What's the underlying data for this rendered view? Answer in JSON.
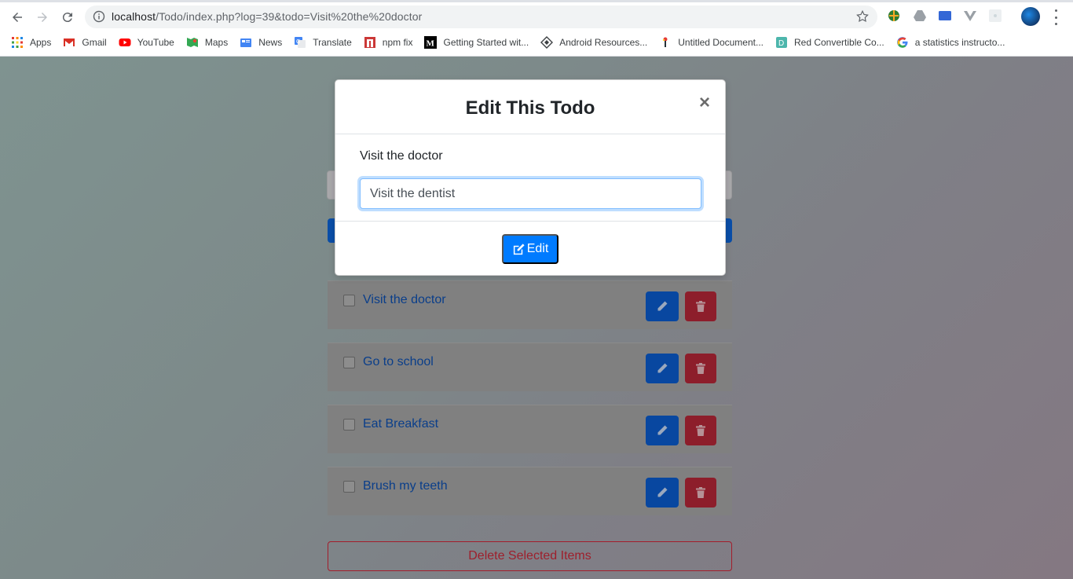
{
  "browser": {
    "url_host": "localhost",
    "url_rest": "/Todo/index.php?log=39&todo=Visit%20the%20doctor",
    "bookmarks": [
      {
        "label": "Apps",
        "icon": "apps-grid-icon"
      },
      {
        "label": "Gmail",
        "icon": "gmail-icon"
      },
      {
        "label": "YouTube",
        "icon": "youtube-icon"
      },
      {
        "label": "Maps",
        "icon": "maps-icon"
      },
      {
        "label": "News",
        "icon": "news-icon"
      },
      {
        "label": "Translate",
        "icon": "translate-icon"
      },
      {
        "label": "npm fix",
        "icon": "npm-icon"
      },
      {
        "label": "Getting Started wit...",
        "icon": "medium-icon"
      },
      {
        "label": "Android Resources...",
        "icon": "android-resources-icon"
      },
      {
        "label": "Untitled Document...",
        "icon": "document-icon"
      },
      {
        "label": "Red Convertible Co...",
        "icon": "d-icon"
      },
      {
        "label": "a statistics instructo...",
        "icon": "google-icon"
      }
    ]
  },
  "modal": {
    "title": "Edit This Todo",
    "close": "×",
    "current_label": "Visit the doctor",
    "input_value": "Visit the dentist",
    "edit_button": "Edit"
  },
  "todos": [
    {
      "text": "Visit the doctor"
    },
    {
      "text": "Go to school"
    },
    {
      "text": "Eat Breakfast"
    },
    {
      "text": "Brush my teeth"
    }
  ],
  "delete_selected": "Delete Selected Items",
  "colors": {
    "primary": "#007bff",
    "danger": "#dc3545"
  }
}
